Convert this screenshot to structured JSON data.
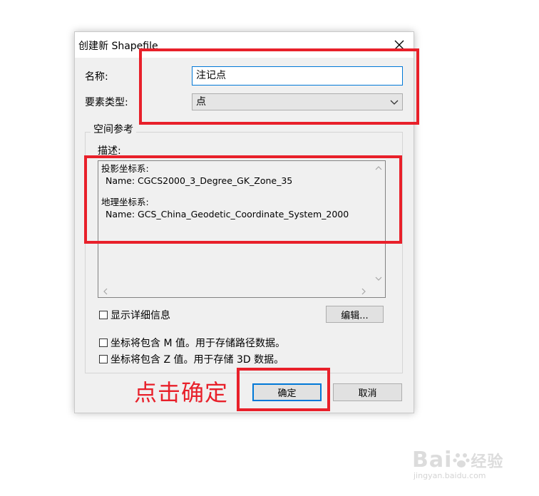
{
  "dialog": {
    "title": "创建新 Shapefile",
    "name_label": "名称:",
    "name_value": "注记点",
    "feature_type_label": "要素类型:",
    "feature_type_value": "点",
    "spatial_ref_legend": "空间参考",
    "description_label": "描述:",
    "description": {
      "projected_heading": "投影坐标系:",
      "projected_name": "Name: CGCS2000_3_Degree_GK_Zone_35",
      "geographic_heading": "地理坐标系:",
      "geographic_name": "Name: GCS_China_Geodetic_Coordinate_System_2000"
    },
    "show_details_label": "显示详细信息",
    "edit_button": "编辑...",
    "m_values_label": "坐标将包含 M 值。用于存储路径数据。",
    "z_values_label": "坐标将包含 Z 值。用于存储 3D 数据。",
    "ok_button": "确定",
    "cancel_button": "取消"
  },
  "annotation": {
    "text": "点击确定",
    "color": "#e8202a"
  },
  "watermark": {
    "logo_text": "Bai",
    "logo_suffix": "经验",
    "url": "jingyan.baidu.com"
  }
}
